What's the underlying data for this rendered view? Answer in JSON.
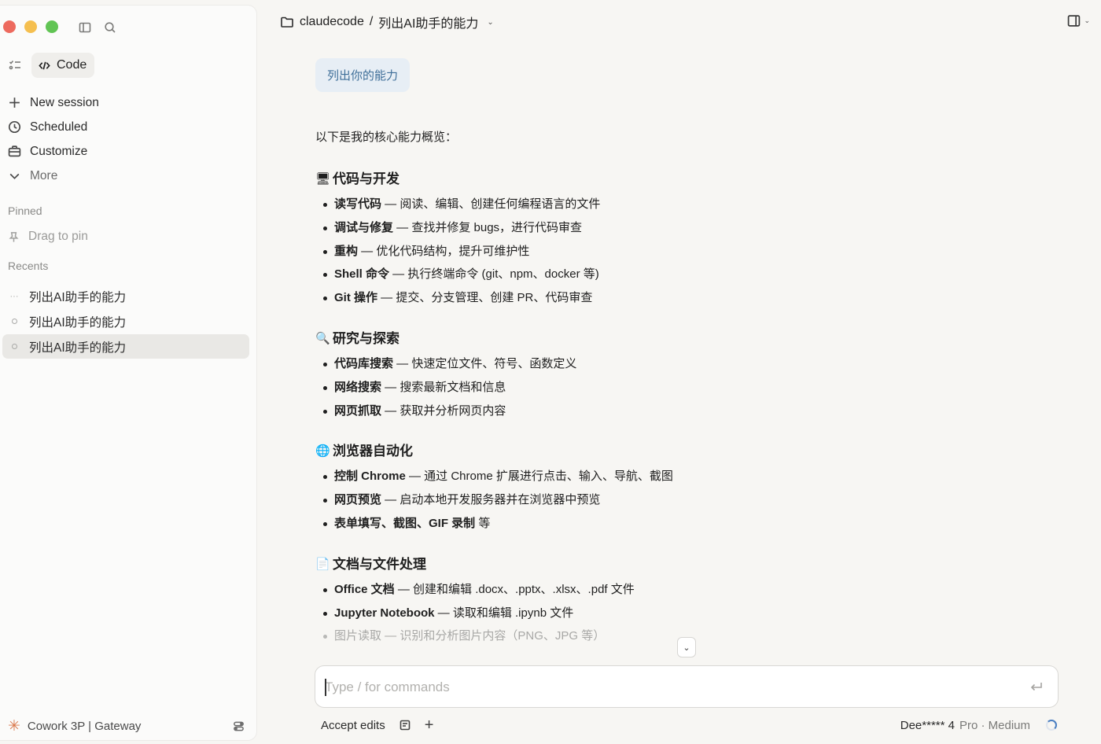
{
  "window": {
    "breadcrumb_folder": "claudecode",
    "breadcrumb_separator": "/",
    "breadcrumb_title": "列出AI助手的能力"
  },
  "sidebar": {
    "mode_label": "Code",
    "nav": [
      {
        "label": "New session",
        "icon": "plus-icon"
      },
      {
        "label": "Scheduled",
        "icon": "clock-icon"
      },
      {
        "label": "Customize",
        "icon": "briefcase-icon"
      },
      {
        "label": "More",
        "icon": "chevron-down-icon"
      }
    ],
    "pinned_label": "Pinned",
    "pin_placeholder": "Drag to pin",
    "recents_label": "Recents",
    "recents": [
      {
        "label": "列出AI助手的能力",
        "state": "running"
      },
      {
        "label": "列出AI助手的能力",
        "state": "idle"
      },
      {
        "label": "列出AI助手的能力",
        "state": "active"
      }
    ],
    "footer_label": "Cowork 3P | Gateway"
  },
  "conversation": {
    "user_message": "列出你的能力",
    "intro": "以下是我的核心能力概览：",
    "sections": [
      {
        "emoji": "🖥",
        "title": "代码与开发",
        "items": [
          {
            "bold": "读写代码",
            "rest": " — 阅读、编辑、创建任何编程语言的文件"
          },
          {
            "bold": "调试与修复",
            "rest": " — 查找并修复 bugs，进行代码审查"
          },
          {
            "bold": "重构",
            "rest": " — 优化代码结构，提升可维护性"
          },
          {
            "bold": "Shell 命令",
            "rest": " — 执行终端命令 (git、npm、docker 等)"
          },
          {
            "bold": "Git 操作",
            "rest": " — 提交、分支管理、创建 PR、代码审查"
          }
        ]
      },
      {
        "emoji": "🔍",
        "title": "研究与探索",
        "items": [
          {
            "bold": "代码库搜索",
            "rest": " — 快速定位文件、符号、函数定义"
          },
          {
            "bold": "网络搜索",
            "rest": " — 搜索最新文档和信息"
          },
          {
            "bold": "网页抓取",
            "rest": " — 获取并分析网页内容"
          }
        ]
      },
      {
        "emoji": "🌐",
        "title": "浏览器自动化",
        "items": [
          {
            "bold": "控制 Chrome",
            "rest": " — 通过 Chrome 扩展进行点击、输入、导航、截图"
          },
          {
            "bold": "网页预览",
            "rest": " — 启动本地开发服务器并在浏览器中预览"
          },
          {
            "bold": "表单填写、截图、GIF 录制",
            "rest": " 等"
          }
        ]
      },
      {
        "emoji": "📄",
        "title": "文档与文件处理",
        "items": [
          {
            "bold": "Office 文档",
            "rest": " — 创建和编辑 .docx、.pptx、.xlsx、.pdf 文件"
          },
          {
            "bold": "Jupyter Notebook",
            "rest": " — 读取和编辑 .ipynb 文件"
          },
          {
            "bold": "图片读取",
            "rest": " — 识别和分析图片内容（PNG、JPG 等）"
          }
        ]
      }
    ]
  },
  "composer": {
    "placeholder": "Type / for commands",
    "value": ""
  },
  "bottom_bar": {
    "accept_edits_label": "Accept edits",
    "add_label": "+",
    "model_name": "Dee***** 4",
    "model_meta": "Pro · Medium"
  }
}
